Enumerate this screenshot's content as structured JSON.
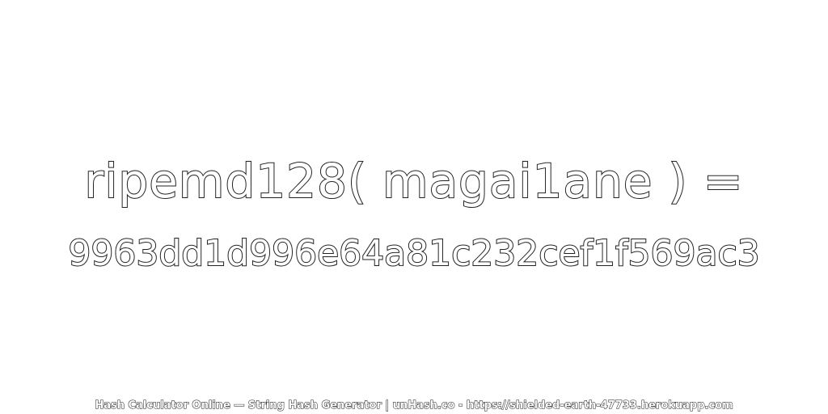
{
  "expression": "ripemd128( magai1ane ) =",
  "hash_value": "9963dd1d996e64a81c232cef1f569ac3",
  "footer_text": "Hash Calculator Online — String Hash Generator | unHash.co - https://shielded-earth-47733.herokuapp.com",
  "colors": {
    "background": "#ffffff",
    "text_fill": "#ffffff",
    "text_outline": "#222222"
  }
}
